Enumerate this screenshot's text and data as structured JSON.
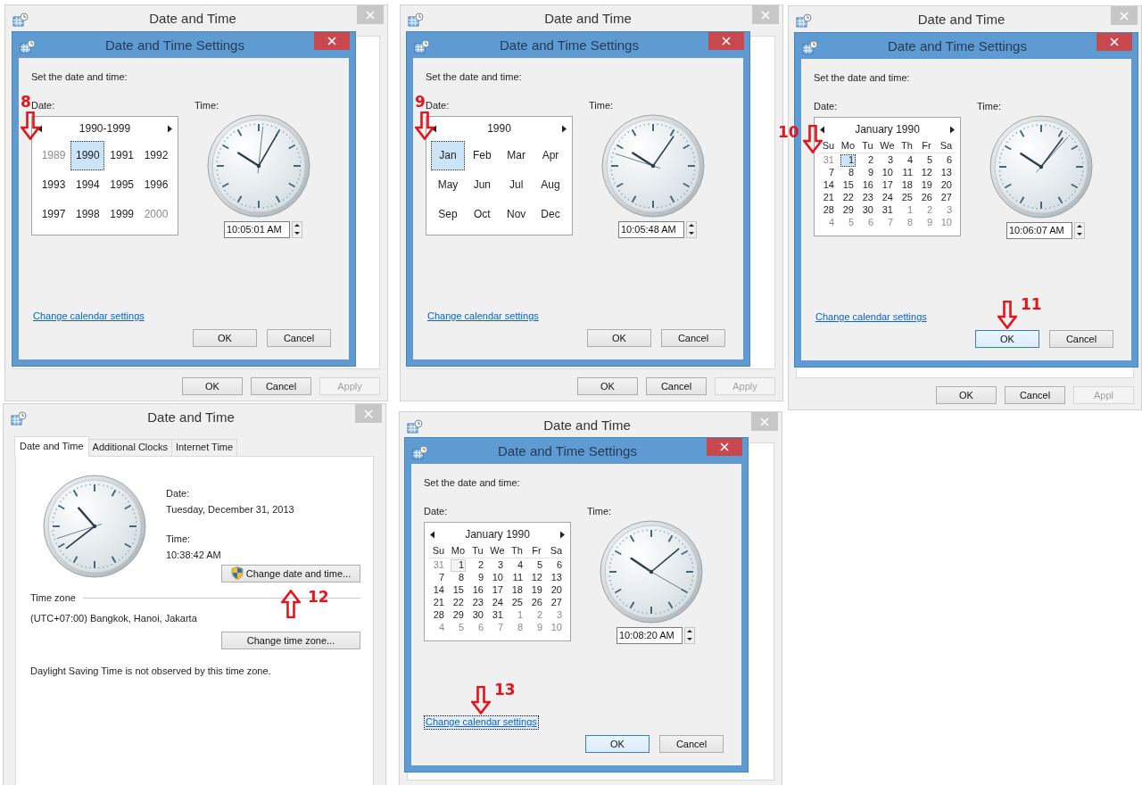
{
  "panels": [
    {
      "kind": "settings_dialog",
      "window": {
        "title": "Date and Time",
        "buttons": [
          {
            "label": "OK",
            "disabled": false
          },
          {
            "label": "Cancel",
            "disabled": false
          },
          {
            "label": "Apply",
            "disabled": true
          }
        ]
      },
      "dialog": {
        "title": "Date and Time Settings",
        "prompt": "Set the date and time:",
        "date_label": "Date:",
        "time_label": "Time:",
        "calendar": {
          "kind": "decade",
          "header": "1990-1999",
          "focused": true,
          "cells": [
            {
              "label": "1989",
              "outside": true,
              "selected": false
            },
            {
              "label": "1990",
              "outside": false,
              "selected": true,
              "annotation": {
                "label": "8",
                "kind": "down"
              }
            },
            {
              "label": "1991",
              "outside": false,
              "selected": false
            },
            {
              "label": "1992",
              "outside": false,
              "selected": false
            },
            {
              "label": "1993",
              "outside": false,
              "selected": false
            },
            {
              "label": "1994",
              "outside": false,
              "selected": false
            },
            {
              "label": "1995",
              "outside": false,
              "selected": false
            },
            {
              "label": "1996",
              "outside": false,
              "selected": false
            },
            {
              "label": "1997",
              "outside": false,
              "selected": false
            },
            {
              "label": "1998",
              "outside": false,
              "selected": false
            },
            {
              "label": "1999",
              "outside": false,
              "selected": false
            },
            {
              "label": "2000",
              "outside": true,
              "selected": false
            }
          ]
        },
        "time": "10:05:01 AM",
        "link": {
          "label": "Change calendar settings",
          "focused": false
        },
        "buttons": [
          {
            "label": "OK",
            "default": false
          },
          {
            "label": "Cancel",
            "default": false
          }
        ]
      }
    },
    {
      "kind": "settings_dialog",
      "window": {
        "title": "Date and Time",
        "buttons": [
          {
            "label": "OK",
            "disabled": false
          },
          {
            "label": "Cancel",
            "disabled": false
          },
          {
            "label": "Apply",
            "disabled": true
          }
        ]
      },
      "dialog": {
        "title": "Date and Time Settings",
        "prompt": "Set the date and time:",
        "date_label": "Date:",
        "time_label": "Time:",
        "calendar": {
          "kind": "year",
          "header": "1990",
          "focused": true,
          "cells": [
            {
              "label": "Jan",
              "outside": false,
              "selected": true,
              "annotation": {
                "label": "9",
                "kind": "down"
              }
            },
            {
              "label": "Feb",
              "outside": false,
              "selected": false
            },
            {
              "label": "Mar",
              "outside": false,
              "selected": false
            },
            {
              "label": "Apr",
              "outside": false,
              "selected": false
            },
            {
              "label": "May",
              "outside": false,
              "selected": false
            },
            {
              "label": "Jun",
              "outside": false,
              "selected": false
            },
            {
              "label": "Jul",
              "outside": false,
              "selected": false
            },
            {
              "label": "Aug",
              "outside": false,
              "selected": false
            },
            {
              "label": "Sep",
              "outside": false,
              "selected": false
            },
            {
              "label": "Oct",
              "outside": false,
              "selected": false
            },
            {
              "label": "Nov",
              "outside": false,
              "selected": false
            },
            {
              "label": "Dec",
              "outside": false,
              "selected": false
            }
          ]
        },
        "time": "10:05:48 AM",
        "link": {
          "label": "Change calendar settings",
          "focused": false
        },
        "buttons": [
          {
            "label": "OK",
            "default": false
          },
          {
            "label": "Cancel",
            "default": false
          }
        ]
      }
    },
    {
      "kind": "settings_dialog",
      "window": {
        "title": "Date and Time",
        "buttons": [
          {
            "label": "OK",
            "disabled": false
          },
          {
            "label": "Cancel",
            "disabled": false
          },
          {
            "label": "Appl",
            "disabled": true
          }
        ]
      },
      "dialog": {
        "title": "Date and Time Settings",
        "prompt": "Set the date and time:",
        "date_label": "Date:",
        "time_label": "Time:",
        "calendar": {
          "kind": "month",
          "header": "January 1990",
          "focused": true,
          "day_names": [
            "Su",
            "Mo",
            "Tu",
            "We",
            "Th",
            "Fr",
            "Sa"
          ],
          "cells": [
            {
              "label": "31",
              "outside": true,
              "selected": false
            },
            {
              "label": "1",
              "outside": false,
              "selected": true,
              "annotation": {
                "label": "10",
                "kind": "down"
              }
            },
            {
              "label": "2",
              "outside": false,
              "selected": false
            },
            {
              "label": "3",
              "outside": false,
              "selected": false
            },
            {
              "label": "4",
              "outside": false,
              "selected": false
            },
            {
              "label": "5",
              "outside": false,
              "selected": false
            },
            {
              "label": "6",
              "outside": false,
              "selected": false
            },
            {
              "label": "7",
              "outside": false,
              "selected": false
            },
            {
              "label": "8",
              "outside": false,
              "selected": false
            },
            {
              "label": "9",
              "outside": false,
              "selected": false
            },
            {
              "label": "10",
              "outside": false,
              "selected": false
            },
            {
              "label": "11",
              "outside": false,
              "selected": false
            },
            {
              "label": "12",
              "outside": false,
              "selected": false
            },
            {
              "label": "13",
              "outside": false,
              "selected": false
            },
            {
              "label": "14",
              "outside": false,
              "selected": false
            },
            {
              "label": "15",
              "outside": false,
              "selected": false
            },
            {
              "label": "16",
              "outside": false,
              "selected": false
            },
            {
              "label": "17",
              "outside": false,
              "selected": false
            },
            {
              "label": "18",
              "outside": false,
              "selected": false
            },
            {
              "label": "19",
              "outside": false,
              "selected": false
            },
            {
              "label": "20",
              "outside": false,
              "selected": false
            },
            {
              "label": "21",
              "outside": false,
              "selected": false
            },
            {
              "label": "22",
              "outside": false,
              "selected": false
            },
            {
              "label": "23",
              "outside": false,
              "selected": false
            },
            {
              "label": "24",
              "outside": false,
              "selected": false
            },
            {
              "label": "25",
              "outside": false,
              "selected": false
            },
            {
              "label": "26",
              "outside": false,
              "selected": false
            },
            {
              "label": "27",
              "outside": false,
              "selected": false
            },
            {
              "label": "28",
              "outside": false,
              "selected": false
            },
            {
              "label": "29",
              "outside": false,
              "selected": false
            },
            {
              "label": "30",
              "outside": false,
              "selected": false
            },
            {
              "label": "31",
              "outside": false,
              "selected": false
            },
            {
              "label": "1",
              "outside": true,
              "selected": false
            },
            {
              "label": "2",
              "outside": true,
              "selected": false
            },
            {
              "label": "3",
              "outside": true,
              "selected": false
            },
            {
              "label": "4",
              "outside": true,
              "selected": false
            },
            {
              "label": "5",
              "outside": true,
              "selected": false
            },
            {
              "label": "6",
              "outside": true,
              "selected": false
            },
            {
              "label": "7",
              "outside": true,
              "selected": false
            },
            {
              "label": "8",
              "outside": true,
              "selected": false
            },
            {
              "label": "9",
              "outside": true,
              "selected": false
            },
            {
              "label": "10",
              "outside": true,
              "selected": false
            }
          ]
        },
        "time": "10:06:07 AM",
        "link": {
          "label": "Change calendar settings",
          "focused": false
        },
        "buttons": [
          {
            "label": "OK",
            "default": true,
            "annotation": {
              "label": "11",
              "kind": "down"
            }
          },
          {
            "label": "Cancel",
            "default": false
          }
        ]
      }
    },
    {
      "kind": "main_window",
      "window": {
        "title": "Date and Time",
        "tabs": [
          {
            "label": "Date and Time",
            "selected": true
          },
          {
            "label": "Additional Clocks",
            "selected": false
          },
          {
            "label": "Internet Time",
            "selected": false
          }
        ]
      },
      "content": {
        "date_label": "Date:",
        "date_value": "Tuesday, December 31, 2013",
        "time_label": "Time:",
        "time_value": "10:38:42 AM",
        "change_button": "Change date and time...",
        "change_button_annotation": {
          "label": "12",
          "kind": "up"
        },
        "timezone_heading": "Time zone",
        "timezone": "(UTC+07:00) Bangkok, Hanoi, Jakarta",
        "timezone_button": "Change time zone...",
        "dst_note": "Daylight Saving Time is not observed by this time zone."
      }
    },
    {
      "kind": "settings_dialog",
      "window": {
        "title": "Date and Time"
      },
      "dialog": {
        "title": "Date and Time Settings",
        "prompt": "Set the date and time:",
        "date_label": "Date:",
        "time_label": "Time:",
        "calendar": {
          "kind": "month",
          "header": "January 1990",
          "focused": false,
          "day_names": [
            "Su",
            "Mo",
            "Tu",
            "We",
            "Th",
            "Fr",
            "Sa"
          ],
          "cells": [
            {
              "label": "31",
              "outside": true,
              "selected": false
            },
            {
              "label": "1",
              "outside": false,
              "selected": true
            },
            {
              "label": "2",
              "outside": false,
              "selected": false
            },
            {
              "label": "3",
              "outside": false,
              "selected": false
            },
            {
              "label": "4",
              "outside": false,
              "selected": false
            },
            {
              "label": "5",
              "outside": false,
              "selected": false
            },
            {
              "label": "6",
              "outside": false,
              "selected": false
            },
            {
              "label": "7",
              "outside": false,
              "selected": false
            },
            {
              "label": "8",
              "outside": false,
              "selected": false
            },
            {
              "label": "9",
              "outside": false,
              "selected": false
            },
            {
              "label": "10",
              "outside": false,
              "selected": false
            },
            {
              "label": "11",
              "outside": false,
              "selected": false
            },
            {
              "label": "12",
              "outside": false,
              "selected": false
            },
            {
              "label": "13",
              "outside": false,
              "selected": false
            },
            {
              "label": "14",
              "outside": false,
              "selected": false
            },
            {
              "label": "15",
              "outside": false,
              "selected": false
            },
            {
              "label": "16",
              "outside": false,
              "selected": false
            },
            {
              "label": "17",
              "outside": false,
              "selected": false
            },
            {
              "label": "18",
              "outside": false,
              "selected": false
            },
            {
              "label": "19",
              "outside": false,
              "selected": false
            },
            {
              "label": "20",
              "outside": false,
              "selected": false
            },
            {
              "label": "21",
              "outside": false,
              "selected": false
            },
            {
              "label": "22",
              "outside": false,
              "selected": false
            },
            {
              "label": "23",
              "outside": false,
              "selected": false
            },
            {
              "label": "24",
              "outside": false,
              "selected": false
            },
            {
              "label": "25",
              "outside": false,
              "selected": false
            },
            {
              "label": "26",
              "outside": false,
              "selected": false
            },
            {
              "label": "27",
              "outside": false,
              "selected": false
            },
            {
              "label": "28",
              "outside": false,
              "selected": false
            },
            {
              "label": "29",
              "outside": false,
              "selected": false
            },
            {
              "label": "30",
              "outside": false,
              "selected": false
            },
            {
              "label": "31",
              "outside": false,
              "selected": false
            },
            {
              "label": "1",
              "outside": true,
              "selected": false
            },
            {
              "label": "2",
              "outside": true,
              "selected": false
            },
            {
              "label": "3",
              "outside": true,
              "selected": false
            },
            {
              "label": "4",
              "outside": true,
              "selected": false
            },
            {
              "label": "5",
              "outside": true,
              "selected": false
            },
            {
              "label": "6",
              "outside": true,
              "selected": false
            },
            {
              "label": "7",
              "outside": true,
              "selected": false
            },
            {
              "label": "8",
              "outside": true,
              "selected": false
            },
            {
              "label": "9",
              "outside": true,
              "selected": false
            },
            {
              "label": "10",
              "outside": true,
              "selected": false
            }
          ]
        },
        "time": "10:08:20 AM",
        "link": {
          "label": "Change calendar settings",
          "focused": true,
          "annotation": {
            "label": "13",
            "kind": "down"
          }
        },
        "buttons": [
          {
            "label": "OK",
            "default": true
          },
          {
            "label": "Cancel",
            "default": false
          }
        ]
      }
    }
  ]
}
